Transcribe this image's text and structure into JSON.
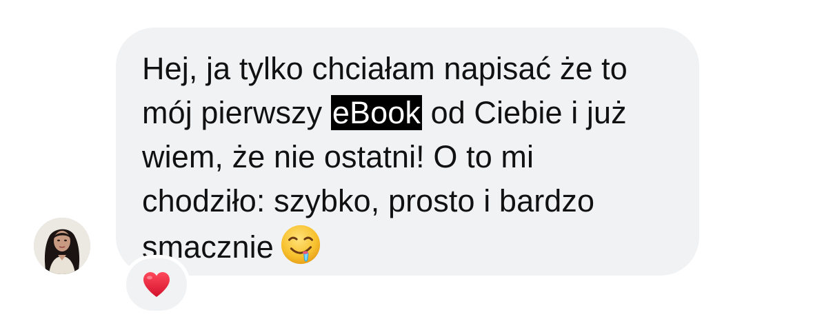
{
  "message": {
    "line1": "Hej, ja tylko chciałam napisać że to",
    "line2_before": "mój pierwszy ",
    "line2_highlight": "eBook",
    "line2_after": " od Ciebie i już",
    "line3": "wiem, że nie ostatni! O to mi",
    "line4": "chodziło: szybko, prosto i bardzo",
    "line5": "smacznie",
    "emoji": "drooling-face-icon"
  },
  "reaction": {
    "emoji": "red-heart-icon"
  },
  "colors": {
    "bubble": "#f1f2f4",
    "text": "#111111",
    "highlight_bg": "#000000",
    "highlight_text": "#ffffff",
    "heart": "#e0243a"
  }
}
